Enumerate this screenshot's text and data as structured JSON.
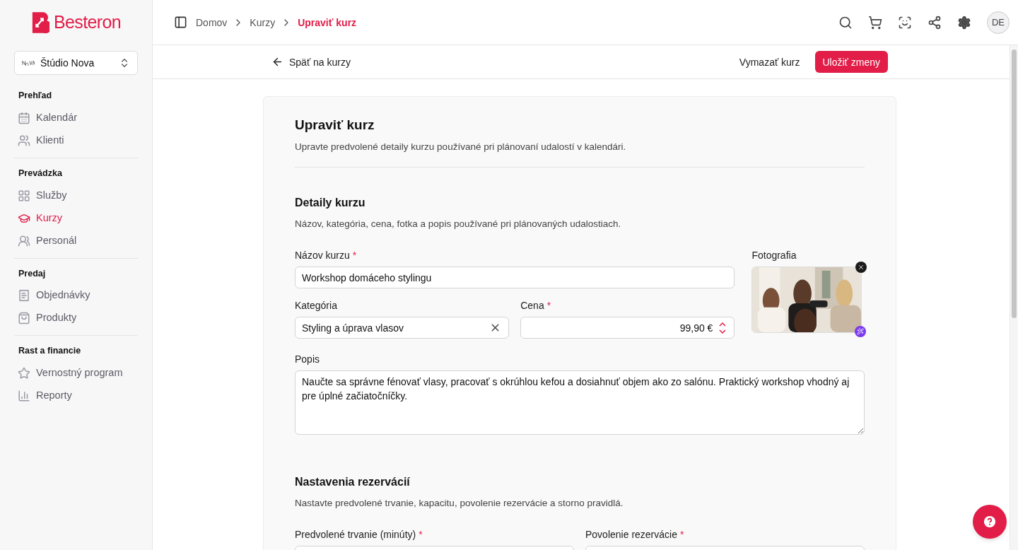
{
  "brand": {
    "name": "Besteron"
  },
  "studio": {
    "name": "Štúdio Nova"
  },
  "sidebar": {
    "sections": [
      {
        "title": "Prehľad",
        "items": [
          {
            "label": "Kalendár",
            "kind": "calendar",
            "selected": false
          },
          {
            "label": "Klienti",
            "kind": "users",
            "selected": false
          }
        ]
      },
      {
        "title": "Prevádzka",
        "items": [
          {
            "label": "Služby",
            "kind": "grid",
            "selected": false
          },
          {
            "label": "Kurzy",
            "kind": "cap",
            "selected": true
          },
          {
            "label": "Personál",
            "kind": "team",
            "selected": false
          }
        ]
      },
      {
        "title": "Predaj",
        "items": [
          {
            "label": "Objednávky",
            "kind": "receipt",
            "selected": false
          },
          {
            "label": "Produkty",
            "kind": "bag",
            "selected": false
          }
        ]
      },
      {
        "title": "Rast a financie",
        "items": [
          {
            "label": "Vernostný program",
            "kind": "star",
            "selected": false
          },
          {
            "label": "Reporty",
            "kind": "chart",
            "selected": false
          }
        ]
      }
    ]
  },
  "breadcrumb": [
    {
      "label": "Domov",
      "current": false
    },
    {
      "label": "Kurzy",
      "current": false
    },
    {
      "label": "Upraviť kurz",
      "current": true
    }
  ],
  "avatar": "DE",
  "toolbar": {
    "back": "Späť na kurzy",
    "delete": "Vymazať kurz",
    "save": "Uložiť zmeny"
  },
  "form": {
    "title": "Upraviť kurz",
    "subtitle": "Upravte predvolené detaily kurzu používané pri plánovaní udalostí v kalendári.",
    "details": {
      "title": "Detaily kurzu",
      "subtitle": "Názov, kategória, cena, fotka a popis používané pri plánovaných udalostiach.",
      "name": {
        "label": "Názov kurzu",
        "required_mark": "*",
        "value": "Workshop domáceho stylingu"
      },
      "category": {
        "label": "Kategória",
        "value": "Styling a úprava vlasov"
      },
      "price": {
        "label": "Cena",
        "required_mark": "*",
        "value": "99,90 €"
      },
      "photo": {
        "label": "Fotografia",
        "kind": "picture"
      },
      "description": {
        "label": "Popis",
        "value": "Naučte sa správne fénovať vlasy, pracovať s okrúhlou kefou a dosiahnuť objem ako zo salónu. Praktický workshop vhodný aj pre úplné začiatočníčky."
      }
    },
    "booking": {
      "title": "Nastavenia rezervácií",
      "subtitle": "Nastavte predvolené trvanie, kapacitu, povolenie rezervácie a storno pravidlá.",
      "fields": [
        {
          "label": "Predvolené trvanie (minúty)",
          "required_mark": "*"
        },
        {
          "label": "Povolenie rezervácie",
          "required_mark": "*"
        }
      ]
    }
  }
}
